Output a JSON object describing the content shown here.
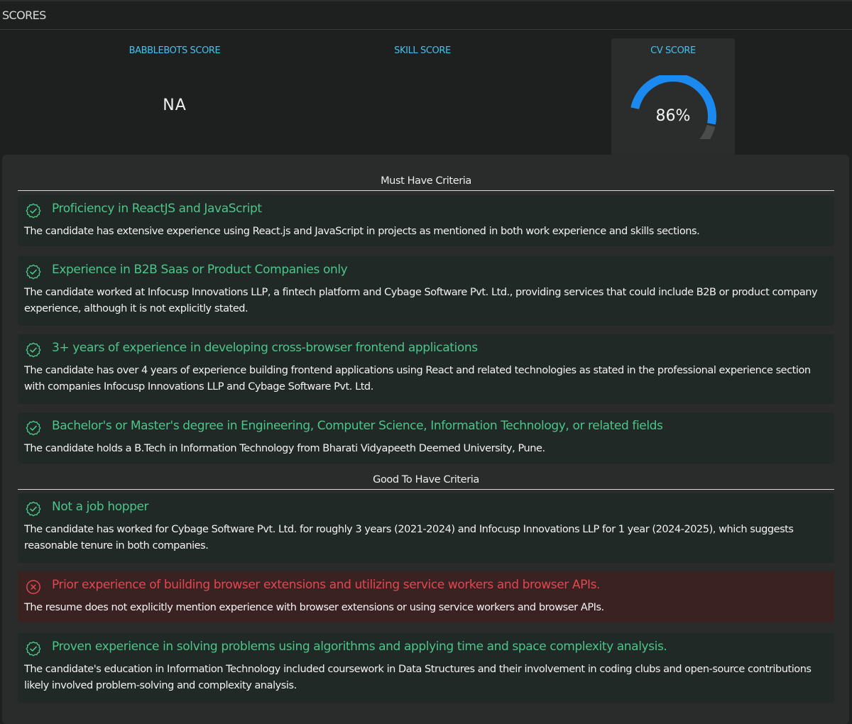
{
  "header": {
    "title": "SCORES"
  },
  "scores": {
    "babblebots": {
      "label": "BABBLEBOTS SCORE",
      "value": "NA"
    },
    "skill": {
      "label": "SKILL SCORE",
      "value": ""
    },
    "cv": {
      "label": "CV SCORE",
      "value_text": "86%",
      "percent": 86
    }
  },
  "colors": {
    "accent": "#44c3ee",
    "gauge_fill": "#1b8af0",
    "gauge_track": "#4a4b4b",
    "pass": "#4bc58a",
    "fail": "#e2474f"
  },
  "must_have": {
    "title": "Must Have Criteria",
    "items": [
      {
        "status": "pass",
        "icon": "check-badge-icon",
        "title": "Proficiency in ReactJS and JavaScript",
        "description": "The candidate has extensive experience using React.js and JavaScript in projects as mentioned in both work experience and skills sections."
      },
      {
        "status": "pass",
        "icon": "check-badge-icon",
        "title": "Experience in B2B Saas or Product Companies only",
        "description": "The candidate worked at Infocusp Innovations LLP, a fintech platform and Cybage Software Pvt. Ltd., providing services that could include B2B or product company experience, although it is not explicitly stated."
      },
      {
        "status": "pass",
        "icon": "check-badge-icon",
        "title": "3+ years of experience in developing cross-browser frontend applications",
        "description": "The candidate has over 4 years of experience building frontend applications using React and related technologies as stated in the professional experience section with companies Infocusp Innovations LLP and Cybage Software Pvt. Ltd."
      },
      {
        "status": "pass",
        "icon": "check-badge-icon",
        "title": "Bachelor's or Master's degree in Engineering, Computer Science, Information Technology, or related fields",
        "description": "The candidate holds a B.Tech in Information Technology from Bharati Vidyapeeth Deemed University, Pune."
      }
    ]
  },
  "good_to_have": {
    "title": "Good To Have Criteria",
    "items": [
      {
        "status": "pass",
        "icon": "check-badge-icon",
        "title": "Not a job hopper",
        "description": "The candidate has worked for Cybage Software Pvt. Ltd. for roughly 3 years (2021-2024) and Infocusp Innovations LLP for 1 year (2024-2025), which suggests reasonable tenure in both companies."
      },
      {
        "status": "fail",
        "icon": "x-circle-icon",
        "title": "Prior experience of building browser extensions and utilizing service workers and browser APIs.",
        "description": "The resume does not explicitly mention experience with browser extensions or using service workers and browser APIs."
      },
      {
        "status": "pass",
        "icon": "check-badge-icon",
        "title": "Proven experience in solving problems using algorithms and applying time and space complexity analysis.",
        "description": "The candidate's education in Information Technology included coursework in Data Structures and their involvement in coding clubs and open-source contributions likely involved problem-solving and complexity analysis."
      }
    ]
  }
}
